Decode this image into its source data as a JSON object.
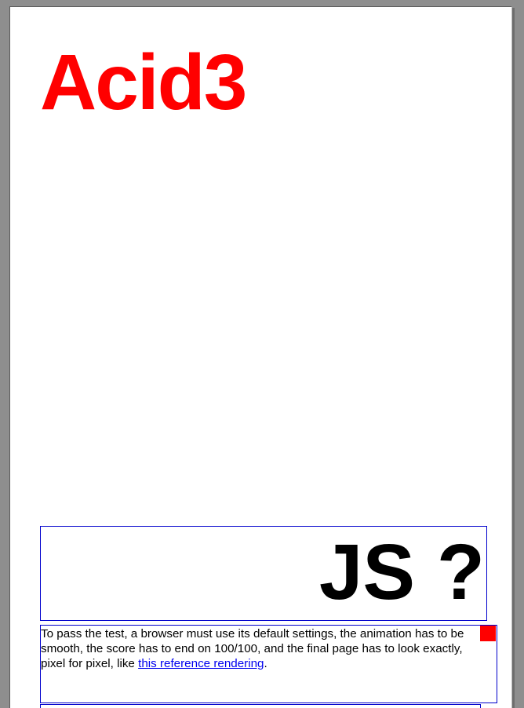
{
  "page": {
    "title": "Acid3",
    "score": "JS ?",
    "instructions": {
      "text_before_link": "To pass the test, a browser must use its default settings, the animation has to be smooth, the score has to end on 100/100, and the final page has to look exactly, pixel for pixel, like ",
      "link_text": "this reference rendering",
      "text_after_link": "."
    }
  },
  "colors": {
    "title": "#ff0000",
    "box_border": "#0000cc",
    "link": "#0000ee",
    "background": "#8e8e8e",
    "page": "#ffffff"
  }
}
